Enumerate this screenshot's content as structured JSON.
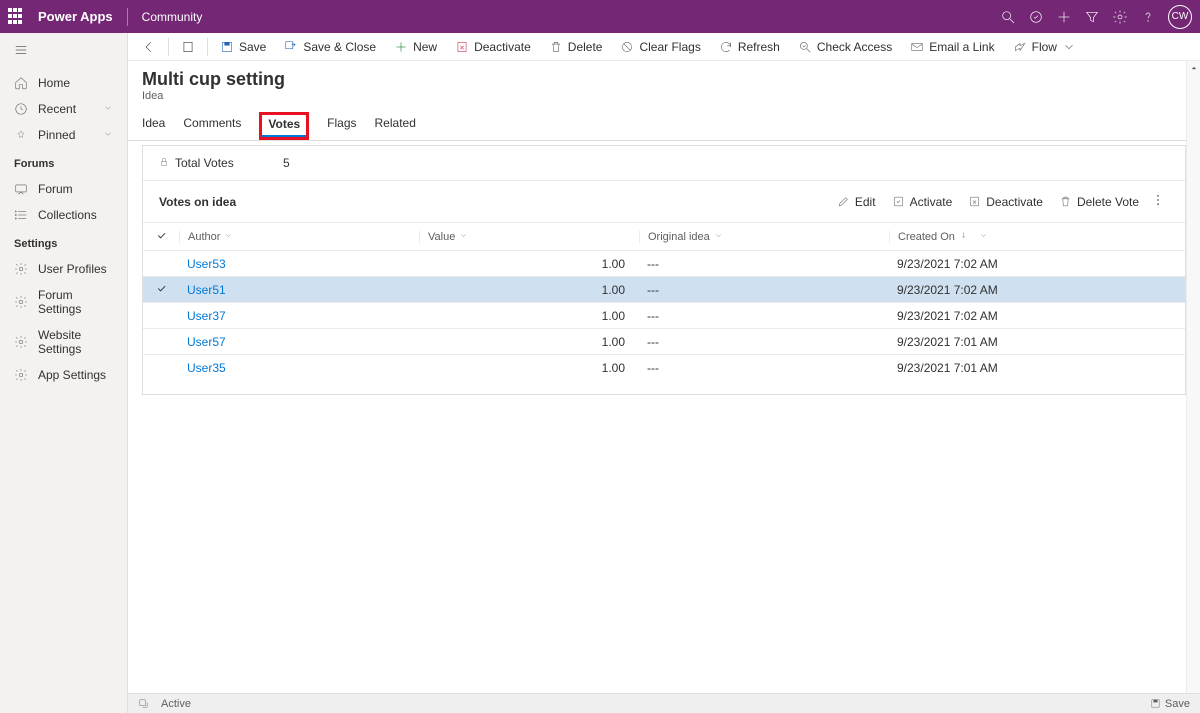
{
  "topbar": {
    "brand": "Power Apps",
    "subbrand": "Community",
    "avatar": "CW"
  },
  "sidebar": {
    "nav": {
      "home": "Home",
      "recent": "Recent",
      "pinned": "Pinned"
    },
    "section_forums": "Forums",
    "forums": {
      "forum": "Forum",
      "collections": "Collections"
    },
    "section_settings": "Settings",
    "settings": {
      "user_profiles": "User Profiles",
      "forum_settings": "Forum Settings",
      "website_settings": "Website Settings",
      "app_settings": "App Settings"
    }
  },
  "commands": {
    "save": "Save",
    "save_close": "Save & Close",
    "new": "New",
    "deactivate": "Deactivate",
    "delete": "Delete",
    "clear_flags": "Clear Flags",
    "refresh": "Refresh",
    "check_access": "Check Access",
    "email_link": "Email a Link",
    "flow": "Flow"
  },
  "page": {
    "title": "Multi cup setting",
    "subtitle": "Idea"
  },
  "tabs": {
    "idea": "Idea",
    "comments": "Comments",
    "votes": "Votes",
    "flags": "Flags",
    "related": "Related"
  },
  "total_votes": {
    "label": "Total Votes",
    "value": "5"
  },
  "subgrid": {
    "title": "Votes on idea",
    "actions": {
      "edit": "Edit",
      "activate": "Activate",
      "deactivate": "Deactivate",
      "delete_vote": "Delete Vote"
    },
    "columns": {
      "author": "Author",
      "value": "Value",
      "original_idea": "Original idea",
      "created_on": "Created On"
    },
    "rows": [
      {
        "author": "User53",
        "value": "1.00",
        "original": "---",
        "created": "9/23/2021 7:02 AM",
        "selected": false
      },
      {
        "author": "User51",
        "value": "1.00",
        "original": "---",
        "created": "9/23/2021 7:02 AM",
        "selected": true
      },
      {
        "author": "User37",
        "value": "1.00",
        "original": "---",
        "created": "9/23/2021 7:02 AM",
        "selected": false
      },
      {
        "author": "User57",
        "value": "1.00",
        "original": "---",
        "created": "9/23/2021 7:01 AM",
        "selected": false
      },
      {
        "author": "User35",
        "value": "1.00",
        "original": "---",
        "created": "9/23/2021 7:01 AM",
        "selected": false
      }
    ]
  },
  "statusbar": {
    "state": "Active",
    "save": "Save"
  }
}
